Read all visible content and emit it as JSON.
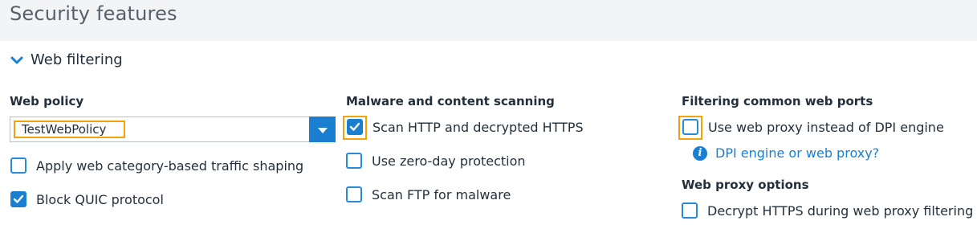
{
  "page": {
    "title": "Security features"
  },
  "section": {
    "title": "Web filtering",
    "expanded": true
  },
  "web_policy": {
    "heading": "Web policy",
    "selected": "TestWebPolicy",
    "options": [
      {
        "label": "Apply web category-based traffic shaping",
        "checked": false
      },
      {
        "label": "Block QUIC protocol",
        "checked": true
      }
    ]
  },
  "malware": {
    "heading": "Malware and content scanning",
    "options": [
      {
        "label": "Scan HTTP and decrypted HTTPS",
        "checked": true
      },
      {
        "label": "Use zero-day protection",
        "checked": false
      },
      {
        "label": "Scan FTP for malware",
        "checked": false
      }
    ]
  },
  "web_ports": {
    "heading": "Filtering common web ports",
    "options": [
      {
        "label": "Use web proxy instead of DPI engine",
        "checked": false
      }
    ],
    "info_link": "DPI engine or web proxy?"
  },
  "proxy_options": {
    "heading": "Web proxy options",
    "options": [
      {
        "label": "Decrypt HTTPS during web proxy filtering",
        "checked": false
      }
    ]
  },
  "colors": {
    "accent": "#1a7fd1",
    "highlight": "#f0a30a",
    "header_bg": "#f3f4f5"
  }
}
